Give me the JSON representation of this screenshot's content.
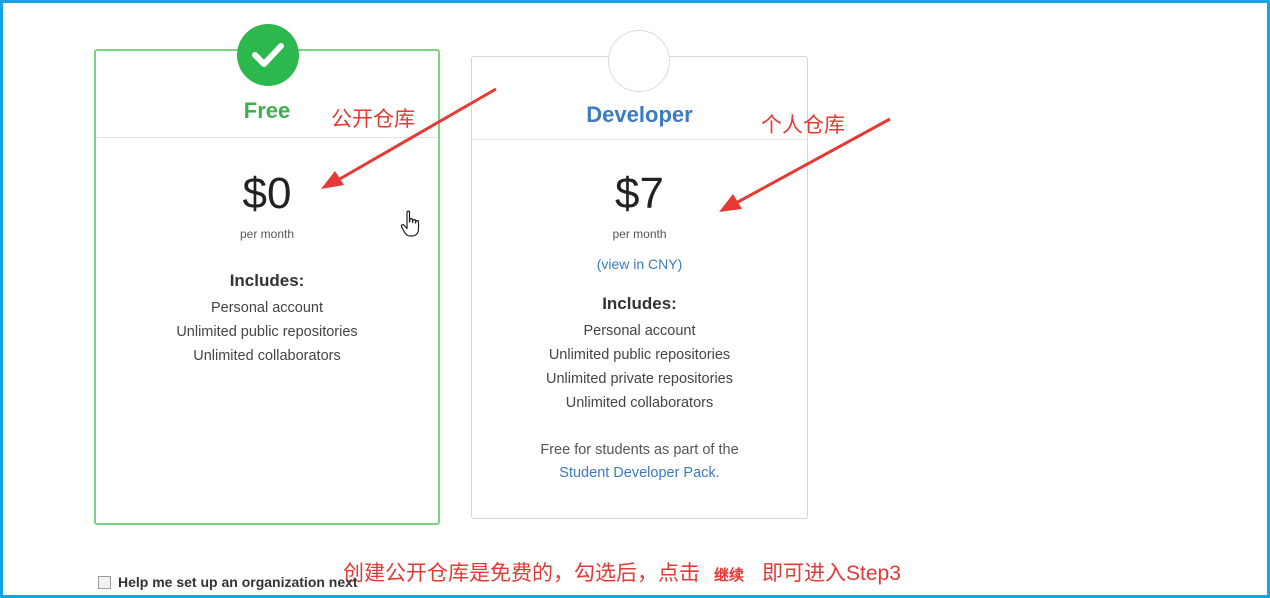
{
  "plans": {
    "free": {
      "name": "Free",
      "price": "$0",
      "period": "per month",
      "includes_title": "Includes:",
      "features": [
        "Personal account",
        "Unlimited public repositories",
        "Unlimited collaborators"
      ]
    },
    "developer": {
      "name": "Developer",
      "price": "$7",
      "period": "per month",
      "currency_link": "(view in CNY)",
      "includes_title": "Includes:",
      "features": [
        "Personal account",
        "Unlimited public repositories",
        "Unlimited private repositories",
        "Unlimited collaborators"
      ],
      "student_note": "Free for students as part of the",
      "student_link": "Student Developer Pack."
    }
  },
  "organization": {
    "label": "Help me set up an organization next",
    "checked": false
  },
  "annotations": {
    "free_note": "公开仓库",
    "developer_note": "个人仓库",
    "bottom_before": "创建公开仓库是免费的，勾选后，点击",
    "bottom_button": "继续",
    "bottom_after": "即可进入Step3"
  },
  "colors": {
    "frame": "#1aa3e2",
    "selected_border": "#7bd37f",
    "check_green": "#2db84d",
    "free_title": "#3fae4c",
    "developer_title": "#3b7bbf",
    "annotation_red": "#e53935"
  }
}
